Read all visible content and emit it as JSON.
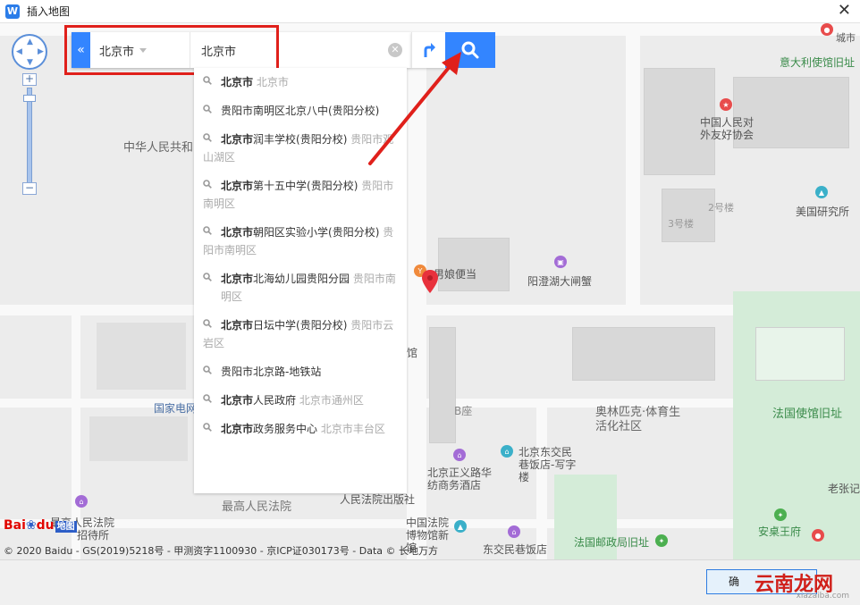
{
  "window": {
    "title": "插入地图",
    "app_icon_letter": "W",
    "close": "✕"
  },
  "search": {
    "collapse_glyph": "«",
    "city": "北京市",
    "query": "北京市"
  },
  "suggestions": [
    {
      "main": "北京市",
      "sub": "北京市"
    },
    {
      "main": "贵阳市南明区北京八中(贵阳分校)",
      "sub": ""
    },
    {
      "main": "北京市润丰学校(贵阳分校)",
      "sub": "贵阳市观山湖区"
    },
    {
      "main": "北京市第十五中学(贵阳分校)",
      "sub": "贵阳市南明区"
    },
    {
      "main": "北京市朝阳区实验小学(贵阳分校)",
      "sub": "贵阳市南明区"
    },
    {
      "main": "北京市北海幼儿园贵阳分园",
      "sub": "贵阳市南明区"
    },
    {
      "main": "北京市日坛中学(贵阳分校)",
      "sub": "贵阳市云岩区"
    },
    {
      "main": "贵阳市北京路-地铁站",
      "sub": ""
    },
    {
      "main": "北京市人民政府",
      "sub": "北京市通州区"
    },
    {
      "main": "北京市政务服务中心",
      "sub": "北京市丰台区"
    }
  ],
  "map_labels": {
    "mps": "中华人民共和国公安部",
    "pffa": "中国人民对外友好协会",
    "us_institute": "美国研究所",
    "no2": "2号楼",
    "no3": "3号楼",
    "italy": "意大利使馆旧址",
    "city_top": "城市",
    "yangcheng": "阳澄湖大闸蟹",
    "bento": "男娘便当",
    "olympic": "奥林匹克·体育生活化社区",
    "france": "法国使馆旧址",
    "national_grid": "国家电网",
    "dongjiao_hotel": "北京东交民巷饭店-写字楼",
    "zhengyi": "北京正义路华纺商务酒店",
    "b_seat": "B座",
    "supreme_court": "最高人民法院",
    "supreme_court_2": "最高人民法院",
    "reception": "招待所",
    "court_press": "人民法院出版社",
    "court_museum": "中国法院博物馆新馆",
    "dongjiao_hotel2": "东交民巷饭店",
    "post_office": "法国邮政局旧址",
    "anqin": "安桌王府",
    "laozhang": "老张记",
    "hall": "馆"
  },
  "map_controls": {
    "zoom_in": "+",
    "zoom_out": "−"
  },
  "baidu": {
    "bai": "Bai",
    "du": "du",
    "map": "地图"
  },
  "copyright": "© 2020 Baidu - GS(2019)5218号 - 甲测资字1100930 - 京ICP证030173号 - Data © 长地万方",
  "ok_button": "确",
  "watermark": "云南龙网",
  "watermark_sub": "xiazaiba.com",
  "colors": {
    "accent": "#3385ff",
    "highlight": "#e0201b",
    "pin": "#e8313c"
  }
}
